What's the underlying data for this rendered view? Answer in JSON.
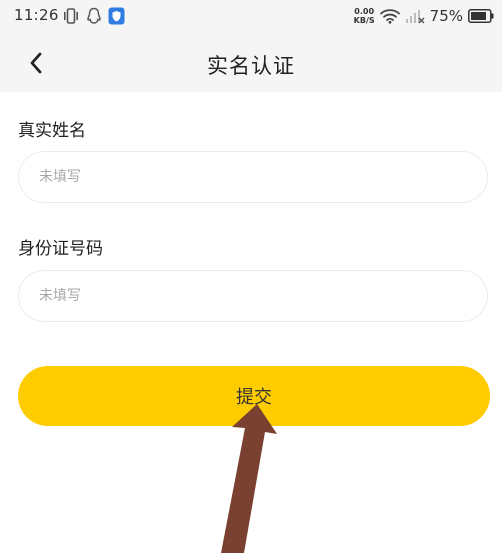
{
  "status_bar": {
    "time": "11:26",
    "network_speed_value": "0.00",
    "network_speed_unit": "KB/S",
    "battery": "75%",
    "icons": [
      "vibrate-icon",
      "qq-icon",
      "shield-app-icon",
      "wifi-icon",
      "signal-off-icon",
      "battery-icon"
    ]
  },
  "header": {
    "title": "实名认证",
    "back_icon": "chevron-left-icon"
  },
  "form": {
    "name_label": "真实姓名",
    "name_placeholder": "未填写",
    "id_label": "身份证号码",
    "id_placeholder": "未填写",
    "submit_label": "提交"
  },
  "colors": {
    "accent": "#ffcc00",
    "header_bg": "#f5f5f5",
    "annotation_arrow": "#7a4030"
  }
}
